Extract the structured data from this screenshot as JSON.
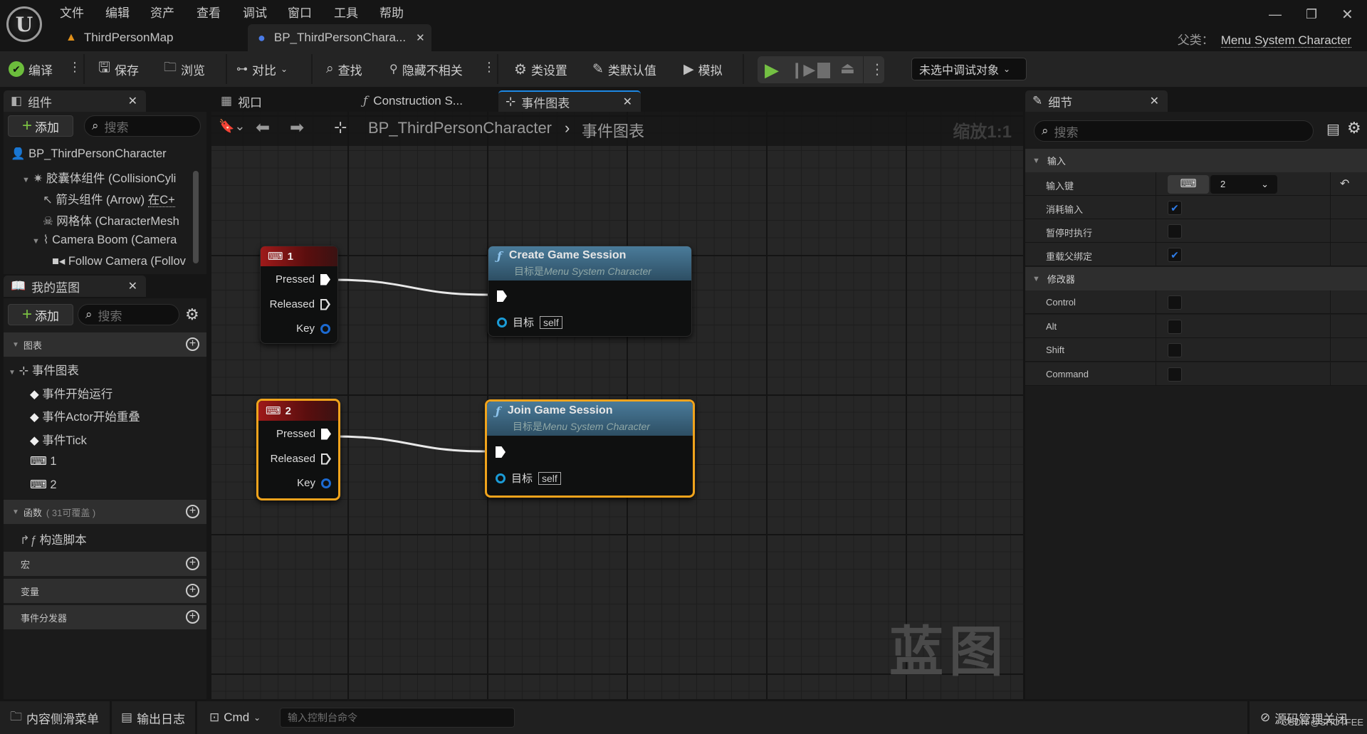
{
  "menu": [
    "文件",
    "编辑",
    "资产",
    "查看",
    "调试",
    "窗口",
    "工具",
    "帮助"
  ],
  "doc_tabs": [
    {
      "label": "ThirdPersonMap",
      "icon": "level-icon",
      "active": false
    },
    {
      "label": "BP_ThirdPersonChara...",
      "icon": "character-blueprint-icon",
      "active": true
    }
  ],
  "parent_class": {
    "label": "父类：",
    "value": "Menu System Character"
  },
  "toolbar": {
    "compile": "编译",
    "save": "保存",
    "browse": "浏览",
    "diff": "对比",
    "find": "查找",
    "hide_unrelated": "隐藏不相关",
    "class_settings": "类设置",
    "class_defaults": "类默认值",
    "simulate": "模拟",
    "debug_target": "未选中调试对象"
  },
  "components_panel": {
    "title": "组件",
    "add": "添加",
    "search_placeholder": "搜索",
    "items": [
      {
        "label": "BP_ThirdPersonCharacter",
        "suffix": "(",
        "icon": "pawn-icon",
        "indent": 0
      },
      {
        "label": "胶囊体组件 (CollisionCyli",
        "icon": "capsule-icon",
        "indent": 1,
        "expanded": true
      },
      {
        "label": "箭头组件 (Arrow)",
        "link": "在C+",
        "icon": "arrow-icon",
        "indent": 2
      },
      {
        "label": "网格体 (CharacterMesh",
        "icon": "skeleton-icon",
        "indent": 2
      },
      {
        "label": "Camera Boom (Camera",
        "icon": "spring-arm-icon",
        "indent": 2,
        "expanded": true
      },
      {
        "label": "Follow Camera (Follov",
        "icon": "camera-icon",
        "indent": 3
      }
    ]
  },
  "my_blueprint": {
    "title": "我的蓝图",
    "add": "添加",
    "search_placeholder": "搜索",
    "graphs_section": "图表",
    "event_graph": "事件图表",
    "events": [
      {
        "label": "事件开始运行",
        "icon": "event-icon"
      },
      {
        "label": "事件Actor开始重叠",
        "icon": "event-icon"
      },
      {
        "label": "事件Tick",
        "icon": "event-icon"
      },
      {
        "label": "1",
        "icon": "keyboard-icon"
      },
      {
        "label": "2",
        "icon": "keyboard-icon"
      }
    ],
    "functions_section": "函数",
    "functions_count": "( 31可覆盖 )",
    "construction_script": "构造脚本",
    "macros": "宏",
    "variables": "变量",
    "dispatchers": "事件分发器"
  },
  "graph_tabs": [
    {
      "label": "视口",
      "icon": "viewport-icon"
    },
    {
      "label": "Construction S...",
      "icon": "function-icon"
    },
    {
      "label": "事件图表",
      "icon": "event-graph-icon",
      "active": true
    }
  ],
  "graph": {
    "breadcrumb_root": "BP_ThirdPersonCharacter",
    "breadcrumb_current": "事件图表",
    "zoom": "缩放1:1",
    "watermark": "蓝图",
    "nodes": [
      {
        "id": "key1",
        "type": "input_key",
        "title": "1",
        "pins": [
          "Pressed",
          "Released",
          "Key"
        ],
        "selected": false
      },
      {
        "id": "create",
        "type": "function",
        "title": "Create Game Session",
        "subtitle_prefix": "目标是",
        "subtitle": "Menu System Character",
        "target_label": "目标",
        "target_value": "self",
        "selected": false
      },
      {
        "id": "key2",
        "type": "input_key",
        "title": "2",
        "pins": [
          "Pressed",
          "Released",
          "Key"
        ],
        "selected": true
      },
      {
        "id": "join",
        "type": "function",
        "title": "Join Game Session",
        "subtitle_prefix": "目标是",
        "subtitle": "Menu System Character",
        "target_label": "目标",
        "target_value": "self",
        "selected": true
      }
    ]
  },
  "details": {
    "title": "细节",
    "search_placeholder": "搜索",
    "input_section": "输入",
    "input_key_label": "输入键",
    "input_key_value": "2",
    "rows": [
      {
        "label": "消耗输入",
        "checked": true
      },
      {
        "label": "暂停时执行",
        "checked": false
      },
      {
        "label": "重载父绑定",
        "checked": true
      }
    ],
    "modifiers_section": "修改器",
    "modifiers": [
      {
        "label": "Control",
        "checked": false
      },
      {
        "label": "Alt",
        "checked": false
      },
      {
        "label": "Shift",
        "checked": false
      },
      {
        "label": "Command",
        "checked": false
      }
    ]
  },
  "bottom": {
    "content_drawer": "内容侧滑菜单",
    "output_log": "输出日志",
    "cmd": "Cmd",
    "cmd_placeholder": "输入控制台命令",
    "source_control": "源码管理关闭",
    "watermark": "CSDN @SHOTFEE"
  },
  "colors": {
    "selection": "#f0a31c",
    "event_header": "#9e1a1a",
    "function_header": "#4a7b9a",
    "play": "#74c043",
    "check": "#2e7be6"
  }
}
